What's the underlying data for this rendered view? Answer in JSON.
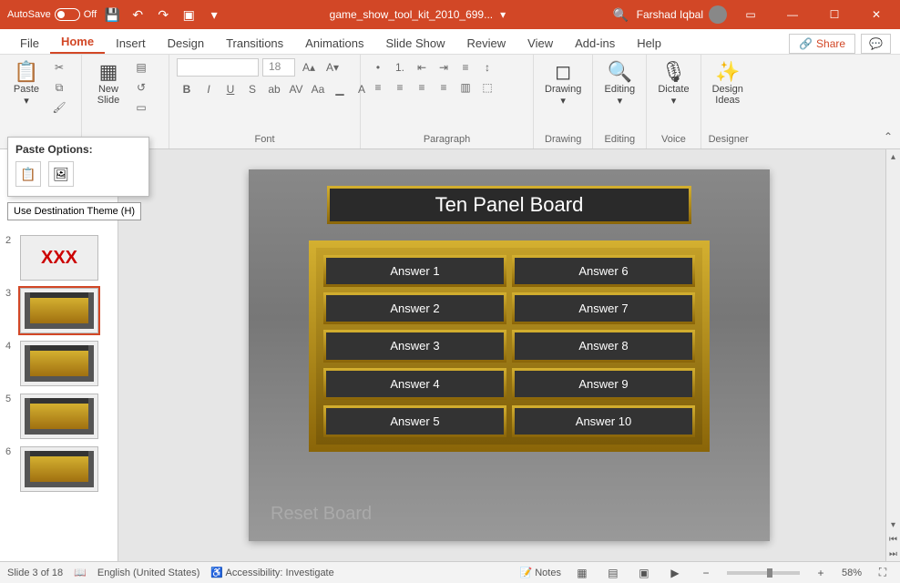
{
  "titlebar": {
    "autosave_label": "AutoSave",
    "autosave_state": "Off",
    "filename": "game_show_tool_kit_2010_699...",
    "username": "Farshad Iqbal"
  },
  "tabs": {
    "file": "File",
    "home": "Home",
    "insert": "Insert",
    "design": "Design",
    "transitions": "Transitions",
    "animations": "Animations",
    "slideshow": "Slide Show",
    "review": "Review",
    "view": "View",
    "addins": "Add-ins",
    "help": "Help",
    "share": "Share"
  },
  "ribbon": {
    "clipboard": {
      "paste": "Paste"
    },
    "slides": {
      "newslide": "New\nSlide"
    },
    "font": {
      "label": "Font",
      "size_placeholder": "18"
    },
    "paragraph": {
      "label": "Paragraph"
    },
    "drawing": {
      "label": "Drawing",
      "btn": "Drawing"
    },
    "editing": {
      "label": "Editing",
      "btn": "Editing"
    },
    "voice": {
      "label": "Voice",
      "btn": "Dictate"
    },
    "designer": {
      "label": "Designer",
      "btn": "Design\nIdeas"
    }
  },
  "paste_dropdown": {
    "header": "Paste Options:",
    "tooltip": "Use Destination Theme (H)"
  },
  "thumbs": {
    "n2": "2",
    "n3": "3",
    "n4": "4",
    "n5": "5",
    "n6": "6"
  },
  "slide": {
    "title": "Ten Panel Board",
    "answers": [
      "Answer  1",
      "Answer 2",
      "Answer 3",
      "Answer 4",
      "Answer 5",
      "Answer 6",
      "Answer 7",
      "Answer 8",
      "Answer 9",
      "Answer 10"
    ],
    "reset": "Reset Board"
  },
  "status": {
    "slide_info": "Slide 3 of 18",
    "language": "English (United States)",
    "accessibility": "Accessibility: Investigate",
    "notes": "Notes",
    "zoom": "58%"
  }
}
